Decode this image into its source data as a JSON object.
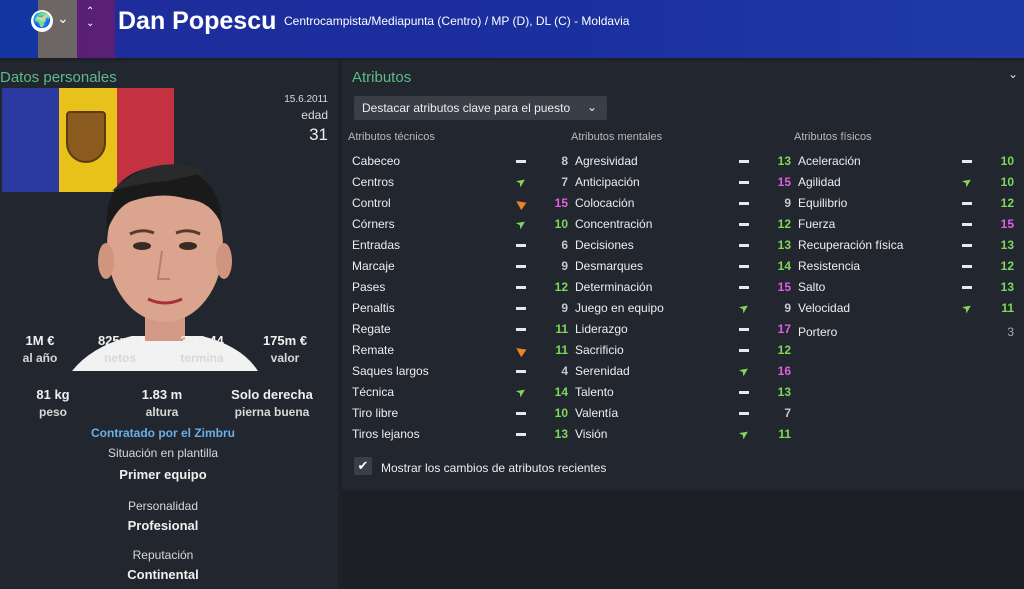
{
  "header": {
    "player_name": "Dan Popescu",
    "subtitle": "Centrocampista/Mediapunta (Centro) / MP (D), DL (C) - Moldavia",
    "flag_colors": [
      "#0046ae",
      "#ffd200",
      "#cc092f"
    ]
  },
  "personal": {
    "title": "Datos personales",
    "date": "15.6.2011",
    "age_label": "edad",
    "age": "31",
    "stats_row1": [
      {
        "value": "1M €",
        "label": "al año"
      },
      {
        "value": "825m €",
        "label": "netos"
      },
      {
        "value": "30.6.44",
        "label": "termina"
      },
      {
        "value": "175m €",
        "label": "valor"
      }
    ],
    "stats_row2": [
      {
        "value": "81 kg",
        "label": "peso"
      },
      {
        "value": "1.83 m",
        "label": "altura"
      },
      {
        "value": "Solo derecha",
        "label": "pierna buena"
      }
    ],
    "contracted_by": "Contratado por el Zimbru",
    "squad_status_label": "Situación en plantilla",
    "squad_status": "Primer equipo",
    "personality_label": "Personalidad",
    "personality": "Profesional",
    "reputation_label": "Reputación",
    "reputation": "Continental"
  },
  "attributes": {
    "title": "Atributos",
    "highlight_dropdown": "Destacar atributos clave para el puesto",
    "show_changes_label": "Mostrar los cambios de atributos recientes",
    "show_changes_checked": true,
    "columns": [
      {
        "header": "Atributos técnicos",
        "rows": [
          {
            "name": "Cabeceo",
            "trend": "flat",
            "value": "8",
            "color": "#c8c8c8"
          },
          {
            "name": "Centros",
            "trend": "up",
            "value": "7",
            "color": "#c8c8c8"
          },
          {
            "name": "Control",
            "trend": "down",
            "value": "15",
            "color": "#e060e0"
          },
          {
            "name": "Córners",
            "trend": "up",
            "value": "10",
            "color": "#7fd85a"
          },
          {
            "name": "Entradas",
            "trend": "flat",
            "value": "6",
            "color": "#c8c8c8"
          },
          {
            "name": "Marcaje",
            "trend": "flat",
            "value": "9",
            "color": "#c8c8c8"
          },
          {
            "name": "Pases",
            "trend": "flat",
            "value": "12",
            "color": "#7fd85a"
          },
          {
            "name": "Penaltis",
            "trend": "flat",
            "value": "9",
            "color": "#c8c8c8"
          },
          {
            "name": "Regate",
            "trend": "flat",
            "value": "11",
            "color": "#7fd85a"
          },
          {
            "name": "Remate",
            "trend": "down",
            "value": "11",
            "color": "#7fd85a"
          },
          {
            "name": "Saques largos",
            "trend": "flat",
            "value": "4",
            "color": "#c8c8c8"
          },
          {
            "name": "Técnica",
            "trend": "up",
            "value": "14",
            "color": "#7fd85a"
          },
          {
            "name": "Tiro libre",
            "trend": "flat",
            "value": "10",
            "color": "#7fd85a"
          },
          {
            "name": "Tiros lejanos",
            "trend": "flat",
            "value": "13",
            "color": "#7fd85a"
          }
        ]
      },
      {
        "header": "Atributos mentales",
        "rows": [
          {
            "name": "Agresividad",
            "trend": "flat",
            "value": "13",
            "color": "#7fd85a"
          },
          {
            "name": "Anticipación",
            "trend": "flat",
            "value": "15",
            "color": "#e060e0"
          },
          {
            "name": "Colocación",
            "trend": "flat",
            "value": "9",
            "color": "#c8c8c8"
          },
          {
            "name": "Concentración",
            "trend": "flat",
            "value": "12",
            "color": "#7fd85a"
          },
          {
            "name": "Decisiones",
            "trend": "flat",
            "value": "13",
            "color": "#7fd85a"
          },
          {
            "name": "Desmarques",
            "trend": "flat",
            "value": "14",
            "color": "#7fd85a"
          },
          {
            "name": "Determinación",
            "trend": "flat",
            "value": "15",
            "color": "#e060e0"
          },
          {
            "name": "Juego en equipo",
            "trend": "up",
            "value": "9",
            "color": "#c8c8c8"
          },
          {
            "name": "Liderazgo",
            "trend": "flat",
            "value": "17",
            "color": "#e060e0"
          },
          {
            "name": "Sacrificio",
            "trend": "flat",
            "value": "12",
            "color": "#7fd85a"
          },
          {
            "name": "Serenidad",
            "trend": "up",
            "value": "16",
            "color": "#e060e0"
          },
          {
            "name": "Talento",
            "trend": "flat",
            "value": "13",
            "color": "#7fd85a"
          },
          {
            "name": "Valentía",
            "trend": "flat",
            "value": "7",
            "color": "#c8c8c8"
          },
          {
            "name": "Visión",
            "trend": "up",
            "value": "11",
            "color": "#7fd85a"
          }
        ]
      },
      {
        "header": "Atributos físicos",
        "rows": [
          {
            "name": "Aceleración",
            "trend": "flat",
            "value": "10",
            "color": "#7fd85a"
          },
          {
            "name": "Agilidad",
            "trend": "up",
            "value": "10",
            "color": "#7fd85a"
          },
          {
            "name": "Equilibrio",
            "trend": "flat",
            "value": "12",
            "color": "#7fd85a"
          },
          {
            "name": "Fuerza",
            "trend": "flat",
            "value": "15",
            "color": "#e060e0"
          },
          {
            "name": "Recuperación física",
            "trend": "flat",
            "value": "13",
            "color": "#7fd85a"
          },
          {
            "name": "Resistencia",
            "trend": "flat",
            "value": "12",
            "color": "#7fd85a"
          },
          {
            "name": "Salto",
            "trend": "flat",
            "value": "13",
            "color": "#7fd85a"
          },
          {
            "name": "Velocidad",
            "trend": "up",
            "value": "11",
            "color": "#7fd85a"
          }
        ],
        "extra": {
          "name": "Portero",
          "value": "3"
        }
      }
    ]
  }
}
